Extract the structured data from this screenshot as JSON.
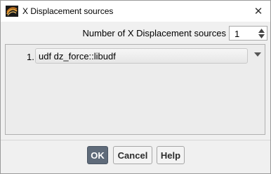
{
  "window": {
    "title": "X Displacement sources",
    "close_glyph": "✕"
  },
  "count": {
    "label": "Number of X Displacement sources",
    "value": "1"
  },
  "sources": [
    {
      "index": "1.",
      "value": "udf dz_force::libudf"
    }
  ],
  "buttons": {
    "ok": "OK",
    "cancel": "Cancel",
    "help": "Help"
  },
  "colors": {
    "ok_button": "#5f6b7a",
    "window_bg": "#f0f0f0",
    "titlebar_bg": "#ffffff"
  },
  "icons": {
    "app": "fluent-app-icon",
    "close": "close-icon",
    "spin_up": "chevron-up-icon",
    "spin_down": "chevron-down-icon",
    "dropdown": "dropdown-arrow-icon"
  }
}
